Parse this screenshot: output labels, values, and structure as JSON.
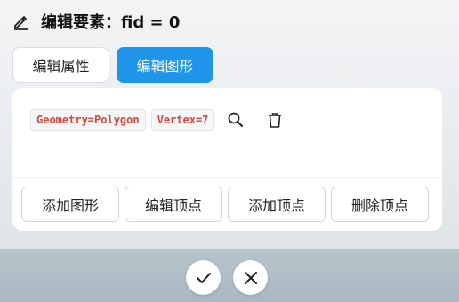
{
  "header": {
    "title": "编辑要素：fid = 0",
    "icon": "edit-pencil-icon"
  },
  "tabs": [
    {
      "label": "编辑属性",
      "active": false
    },
    {
      "label": "编辑图形",
      "active": true
    }
  ],
  "info": {
    "geometry_tag": "Geometry=Polygon",
    "vertex_tag": "Vertex=7",
    "tag_color": "#e0453a"
  },
  "actions": [
    {
      "label": "添加图形"
    },
    {
      "label": "编辑顶点"
    },
    {
      "label": "添加顶点"
    },
    {
      "label": "删除顶点"
    }
  ],
  "footer": {
    "confirm_icon": "check-icon",
    "cancel_icon": "close-icon"
  },
  "colors": {
    "accent": "#1e95e8",
    "footer_bg": "#aebcc5"
  }
}
